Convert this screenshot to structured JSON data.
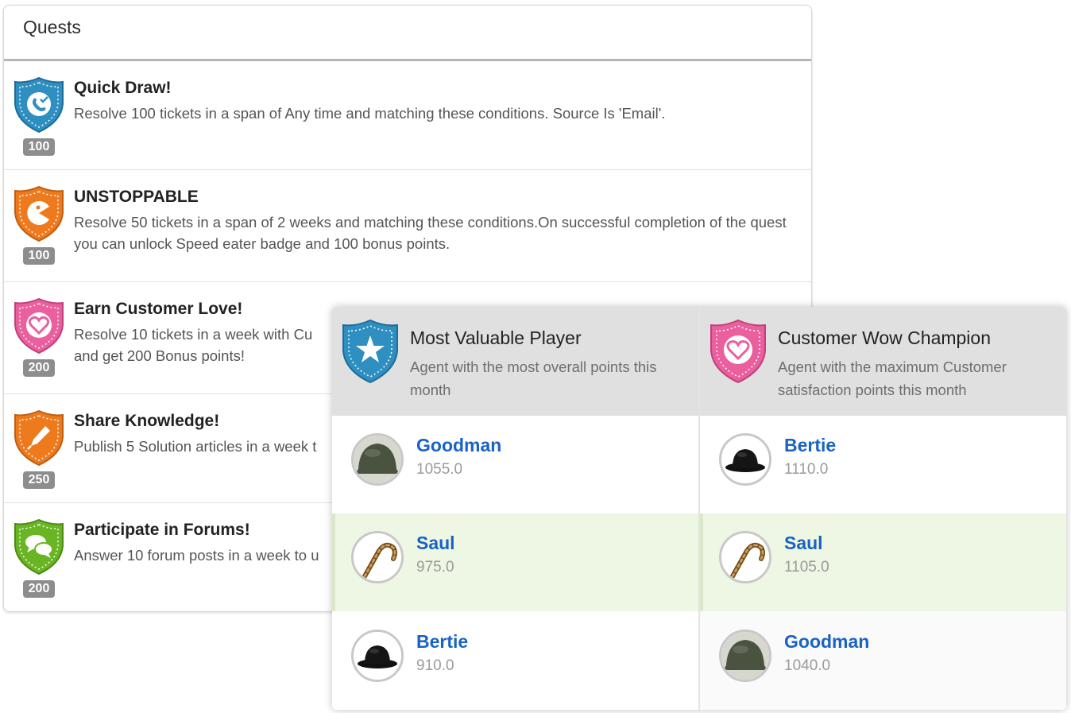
{
  "quests": {
    "title": "Quests",
    "items": [
      {
        "title": "Quick Draw!",
        "description": "Resolve 100 tickets in a span of Any time and matching these conditions. Source Is 'Email'.",
        "points": "100",
        "icon": "phone-icon",
        "color": "#2e8fc0"
      },
      {
        "title": "UNSTOPPABLE",
        "description": "Resolve 50 tickets in a span of 2 weeks and matching these conditions.On successful completion of the quest you can unlock Speed eater badge and 100 bonus points.",
        "points": "100",
        "icon": "pacman-icon",
        "color": "#ee7a1e"
      },
      {
        "title": "Earn Customer Love!",
        "description": "Resolve 10 tickets in a week with Cu",
        "description_line2": "and get 200 Bonus points!",
        "points": "200",
        "icon": "heart-icon",
        "color": "#ea5f9e"
      },
      {
        "title": "Share Knowledge!",
        "description": "Publish 5 Solution articles in a week t",
        "points": "250",
        "icon": "pen-icon",
        "color": "#ee7a1e"
      },
      {
        "title": "Participate in Forums!",
        "description": "Answer 10 forum posts in a week to u",
        "points": "200",
        "icon": "chat-icon",
        "color": "#6ab523"
      }
    ]
  },
  "leaderboard": {
    "columns": [
      {
        "title": "Most Valuable Player",
        "description": "Agent with the most overall points this month",
        "icon": "star-icon",
        "color": "#2e8fc0",
        "rows": [
          {
            "name": "Goodman",
            "score": "1055.0",
            "avatar": "helmet-avatar"
          },
          {
            "name": "Saul",
            "score": "975.0",
            "avatar": "cane-avatar"
          },
          {
            "name": "Bertie",
            "score": "910.0",
            "avatar": "bowler-hat-avatar"
          }
        ]
      },
      {
        "title": "Customer Wow Champion",
        "description": "Agent with the maximum Customer satisfaction points this month",
        "icon": "heart-icon",
        "color": "#ea5f9e",
        "rows": [
          {
            "name": "Bertie",
            "score": "1110.0",
            "avatar": "bowler-hat-avatar"
          },
          {
            "name": "Saul",
            "score": "1105.0",
            "avatar": "cane-avatar"
          },
          {
            "name": "Goodman",
            "score": "1040.0",
            "avatar": "helmet-avatar"
          }
        ]
      }
    ]
  }
}
